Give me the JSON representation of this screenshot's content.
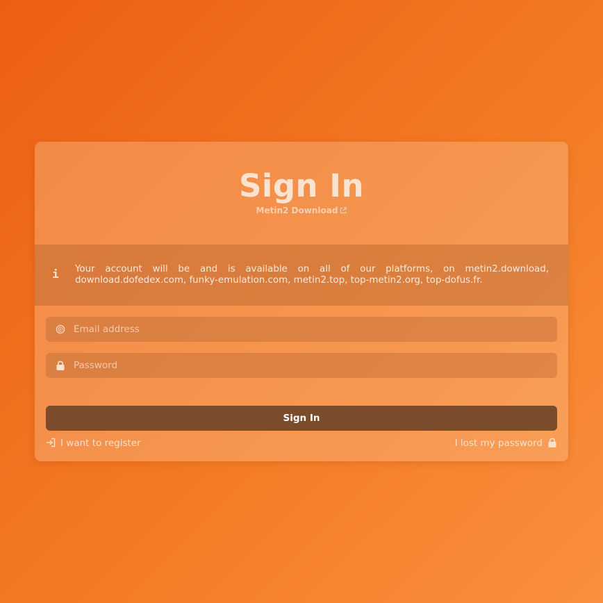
{
  "header": {
    "title": "Sign In",
    "subtitle_link": "Metin2 Download"
  },
  "notice": {
    "icon": "info-icon",
    "text": "Your account will be and is available on all of our platforms, on metin2.download, download.dofedex.com, funky-emulation.com, metin2.top, top-metin2.org, top-dofus.fr."
  },
  "form": {
    "email": {
      "icon": "at-icon",
      "placeholder": "Email address",
      "value": ""
    },
    "password": {
      "icon": "lock-icon",
      "placeholder": "Password",
      "value": ""
    },
    "submit_label": "Sign In"
  },
  "links": {
    "register": {
      "label": "I want to register",
      "icon": "sign-in-icon"
    },
    "lost_password": {
      "label": "I lost my password",
      "icon": "lock-icon"
    }
  },
  "colors": {
    "background_start": "#ec5e14",
    "background_end": "#f98f3e",
    "button": "#7a4c2b",
    "text_light": "#fbe3d2"
  }
}
